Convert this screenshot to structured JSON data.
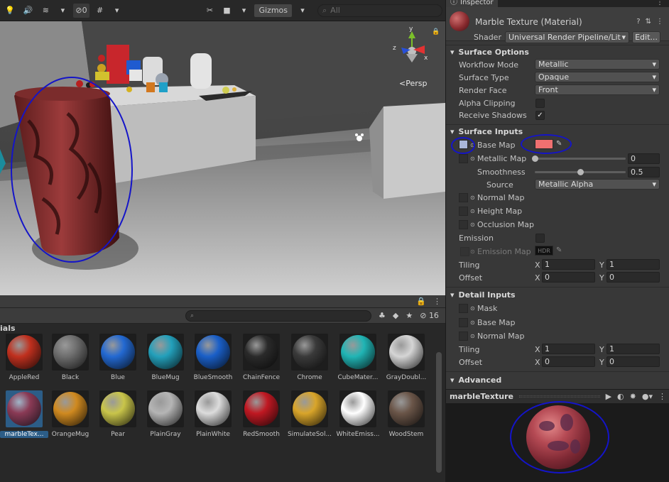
{
  "scene": {
    "toolbar": {
      "hidden_count": "0",
      "gizmos_label": "Gizmos",
      "search_placeholder": "All"
    },
    "persp_label": "<Persp"
  },
  "project": {
    "hidden_count": "16",
    "folder_label": "ials",
    "assets": [
      {
        "name": "AppleRed",
        "color": "#c0301e"
      },
      {
        "name": "Black",
        "color": "#6e6e6e"
      },
      {
        "name": "Blue",
        "color": "#2369d2"
      },
      {
        "name": "BlueMug",
        "color": "#23a0bb"
      },
      {
        "name": "BlueSmooth",
        "color": "#1a5fc8"
      },
      {
        "name": "ChainFence",
        "color": "#2a2a2a"
      },
      {
        "name": "Chrome",
        "color": "#3a3a3a"
      },
      {
        "name": "CubeMater...",
        "color": "#20b5b5"
      },
      {
        "name": "GrayDoubl...",
        "color": "#d5d5d5"
      },
      {
        "name": "marbleTex...",
        "color": "#8a3a55"
      },
      {
        "name": "OrangeMug",
        "color": "#d08a20"
      },
      {
        "name": "Pear",
        "color": "#c9c54a"
      },
      {
        "name": "PlainGray",
        "color": "#b5b5b5"
      },
      {
        "name": "PlainWhite",
        "color": "#dcdcdc"
      },
      {
        "name": "RedSmooth",
        "color": "#c01822"
      },
      {
        "name": "SimulateSol...",
        "color": "#d9a52a"
      },
      {
        "name": "WhiteEmiss...",
        "color": "#ffffff"
      },
      {
        "name": "WoodStem",
        "color": "#6a5548"
      }
    ]
  },
  "inspector": {
    "tab_label": "Inspector",
    "title": "Marble Texture (Material)",
    "shader_label": "Shader",
    "shader_value": "Universal Render Pipeline/Lit",
    "edit_label": "Edit...",
    "surface_options": {
      "header": "Surface Options",
      "workflow_label": "Workflow Mode",
      "workflow_value": "Metallic",
      "surface_type_label": "Surface Type",
      "surface_type_value": "Opaque",
      "render_face_label": "Render Face",
      "render_face_value": "Front",
      "alpha_clipping_label": "Alpha Clipping",
      "receive_shadows_label": "Receive Shadows"
    },
    "surface_inputs": {
      "header": "Surface Inputs",
      "base_map_label": "Base Map",
      "base_color": "#f07070",
      "metallic_map_label": "Metallic Map",
      "metallic_value": "0",
      "smoothness_label": "Smoothness",
      "smoothness_value": "0.5",
      "smoothness_fraction": 0.5,
      "source_label": "Source",
      "source_value": "Metallic Alpha",
      "normal_map_label": "Normal Map",
      "height_map_label": "Height Map",
      "occlusion_map_label": "Occlusion Map",
      "emission_label": "Emission",
      "emission_map_label": "Emission Map",
      "hdr_label": "HDR",
      "tiling_label": "Tiling",
      "tiling_x": "1",
      "tiling_y": "1",
      "offset_label": "Offset",
      "offset_x": "0",
      "offset_y": "0"
    },
    "detail_inputs": {
      "header": "Detail Inputs",
      "mask_label": "Mask",
      "base_map_label": "Base Map",
      "normal_map_label": "Normal Map",
      "tiling_label": "Tiling",
      "tiling_x": "1",
      "tiling_y": "1",
      "offset_label": "Offset",
      "offset_x": "0",
      "offset_y": "0"
    },
    "advanced_header": "Advanced",
    "preview_title": "marbleTexture",
    "axis_x": "X",
    "axis_y": "Y"
  }
}
